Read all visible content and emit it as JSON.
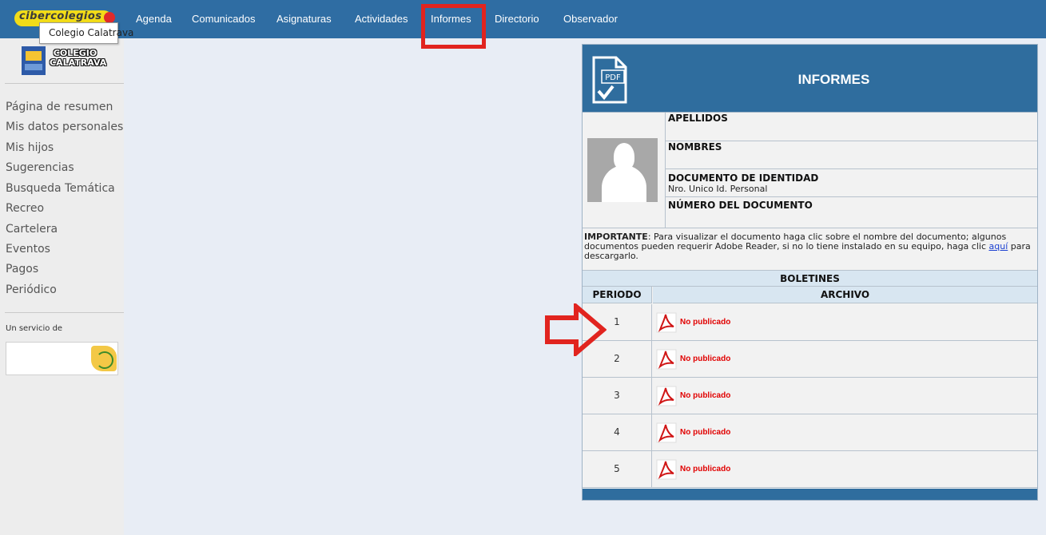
{
  "topbar": {
    "logo_text": "cibercolegios",
    "tooltip": "Colegio Calatrava",
    "nav": [
      {
        "label": "Agenda"
      },
      {
        "label": "Comunicados"
      },
      {
        "label": "Asignaturas"
      },
      {
        "label": "Actividades"
      },
      {
        "label": "Informes",
        "active": true
      },
      {
        "label": "Directorio"
      },
      {
        "label": "Observador"
      }
    ]
  },
  "sidebar": {
    "school_name": "COLEGIO CALATRAVA",
    "links": [
      {
        "label": "Página de resumen"
      },
      {
        "label": "Mis datos personales"
      },
      {
        "label": "Mis hijos"
      },
      {
        "label": "Sugerencias"
      },
      {
        "label": "Busqueda Temática"
      },
      {
        "label": "Recreo"
      },
      {
        "label": "Cartelera"
      },
      {
        "label": "Eventos"
      },
      {
        "label": "Pagos"
      },
      {
        "label": "Periódico"
      }
    ],
    "service_label": "Un servicio de"
  },
  "panel": {
    "title": "INFORMES",
    "pdf_icon_text": "PDF",
    "fields": {
      "apellidos": {
        "label": "APELLIDOS",
        "value": ""
      },
      "nombres": {
        "label": "NOMBRES",
        "value": ""
      },
      "documento": {
        "label": "DOCUMENTO DE IDENTIDAD",
        "value": "Nro. Unico Id. Personal"
      },
      "numero": {
        "label": "NÚMERO DEL DOCUMENTO",
        "value": ""
      }
    },
    "notice": {
      "bold": "IMPORTANTE",
      "text": ": Para visualizar el documento haga clic sobre el nombre del documento; algunos documentos pueden requerir Adobe Reader, si no lo tiene instalado en su equipo, haga clic ",
      "link": "aquí",
      "tail": " para descargarlo."
    },
    "table": {
      "title": "BOLETINES",
      "col_period": "PERIODO",
      "col_file": "ARCHIVO",
      "rows": [
        {
          "period": "1",
          "status": "No publicado"
        },
        {
          "period": "2",
          "status": "No publicado"
        },
        {
          "period": "3",
          "status": "No publicado"
        },
        {
          "period": "4",
          "status": "No publicado"
        },
        {
          "period": "5",
          "status": "No publicado"
        }
      ]
    }
  },
  "colors": {
    "nav_bg": "#2f6da3",
    "panel_header_bg": "#2f6d9e",
    "highlight_red": "#e1241f",
    "status_red": "#e10000",
    "link_blue": "#1a3fd1"
  }
}
